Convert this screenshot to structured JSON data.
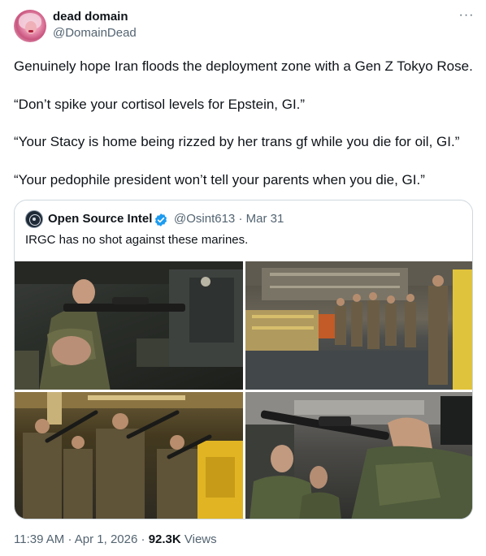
{
  "author": {
    "display_name": "dead domain",
    "handle": "@DomainDead"
  },
  "more_menu": "···",
  "tweet_lines": [
    "Genuinely hope Iran floods the deployment zone with a Gen Z Tokyo Rose.",
    "“Don’t spike your cortisol levels for Epstein, GI.”",
    "“Your Stacy is home being rizzed by her trans gf while you die for oil, GI.”",
    "“Your pedophile president won’t tell your parents when you die, GI.”"
  ],
  "quote": {
    "display_name": "Open Source Intel",
    "verified": true,
    "handle": "@Osint613",
    "separator": "·",
    "date": "Mar 31",
    "text": "IRGC has no shot against these marines."
  },
  "footer": {
    "time": "11:39 AM",
    "separator1": "·",
    "date": "Apr 1, 2026",
    "separator2": "·",
    "views_count": "92.3K",
    "views_label": "Views"
  },
  "colors": {
    "text_primary": "#0f1419",
    "text_secondary": "#536471",
    "border": "#cfd9de",
    "verified_badge": "#1d9bf0"
  }
}
